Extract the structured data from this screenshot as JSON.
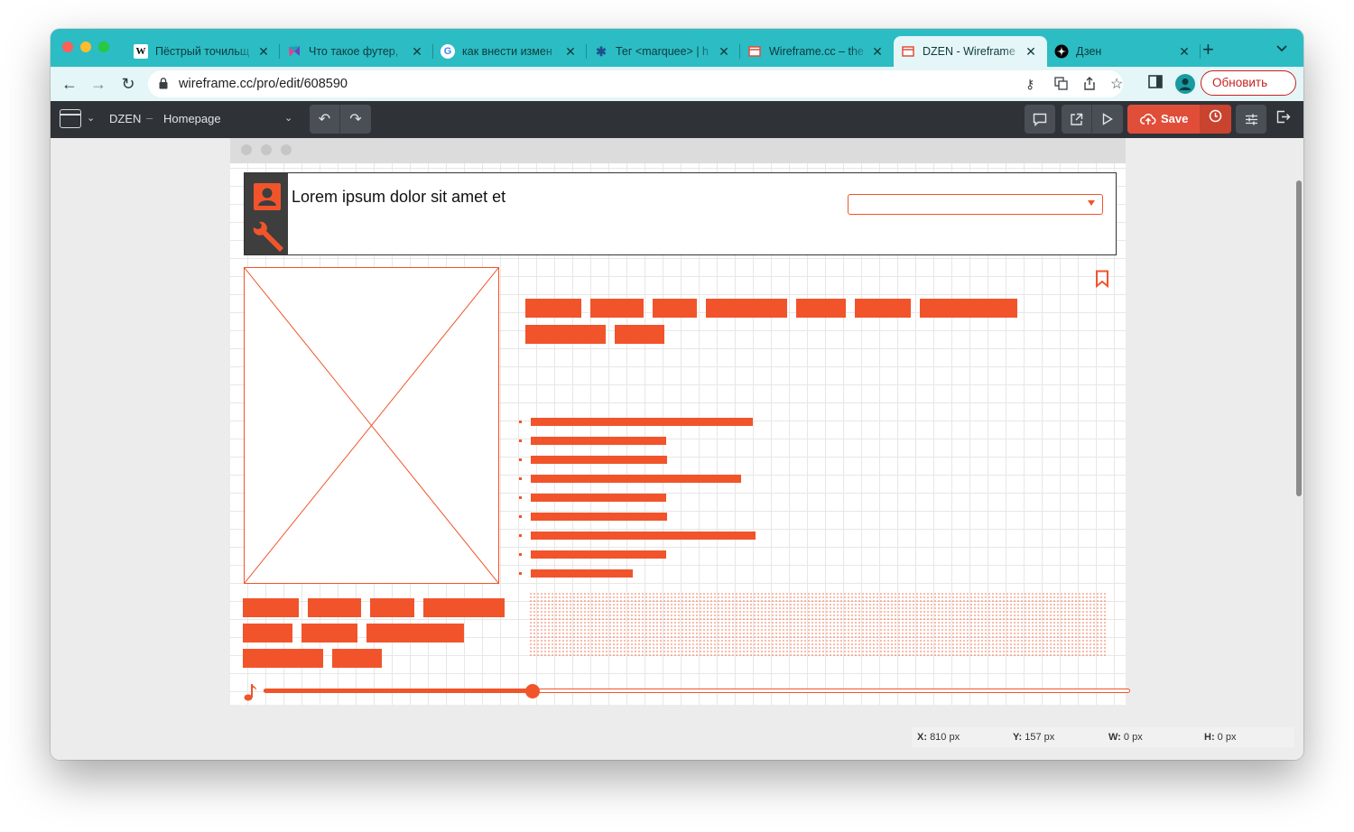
{
  "browser": {
    "traffic_lights": [
      {
        "name": "close",
        "color": "#ff5f57"
      },
      {
        "name": "minimize",
        "color": "#febc2e"
      },
      {
        "name": "zoom",
        "color": "#28c840"
      }
    ],
    "tabs": [
      {
        "favicon": "wikipedia-icon",
        "title": "Пёстрый точильщ",
        "active": false
      },
      {
        "favicon": "colorful-logo-icon",
        "title": "Что такое футер,",
        "active": false
      },
      {
        "favicon": "google-icon",
        "title": "как внести измен",
        "active": false
      },
      {
        "favicon": "spider-icon",
        "title": "Тег <marquee> | h",
        "active": false
      },
      {
        "favicon": "wireframe-icon",
        "title": "Wireframe.cc – the",
        "active": false
      },
      {
        "favicon": "wireframe-icon",
        "title": "DZEN - Wireframe",
        "active": true
      },
      {
        "favicon": "dzen-icon",
        "title": "Дзен",
        "active": false
      }
    ],
    "url": "wireframe.cc/pro/edit/608590",
    "update_label": "Обновить"
  },
  "app": {
    "project": "DZEN",
    "separator": "–",
    "page": "Homepage",
    "save_label": "Save",
    "accent": "#f1542b"
  },
  "wireframe": {
    "header_title": "Lorem ipsum dolor sit amet et",
    "tag_rows_right": [
      [
        62,
        59,
        49,
        90,
        55,
        62,
        108
      ],
      [
        89,
        55
      ]
    ],
    "list_bar_lengths": [
      246,
      150,
      151,
      233,
      150,
      151,
      249,
      150,
      113
    ],
    "tag_rows_left": [
      [
        62,
        59,
        49,
        90
      ],
      [
        55,
        62,
        108
      ],
      [
        89,
        55
      ]
    ],
    "slider_value_percent": 31
  },
  "statusbar": {
    "x_label": "X:",
    "x_value": "810 px",
    "y_label": "Y:",
    "y_value": "157 px",
    "w_label": "W:",
    "w_value": "0 px",
    "h_label": "H:",
    "h_value": "0 px"
  }
}
